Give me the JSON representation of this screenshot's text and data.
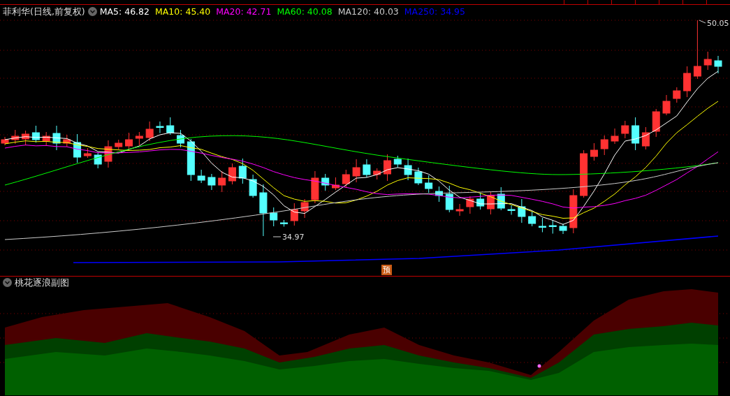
{
  "header": {
    "stock_title": "菲利华(日线,前复权)",
    "moving_averages": [
      {
        "label": "MA5: 46.82",
        "color": "#ffffff"
      },
      {
        "label": "MA10: 45.40",
        "color": "#ffff00"
      },
      {
        "label": "MA20: 42.71",
        "color": "#ff00ff"
      },
      {
        "label": "MA60: 40.08",
        "color": "#00ff00"
      },
      {
        "label": "MA120: 40.03",
        "color": "#c8c8c8"
      },
      {
        "label": "MA250: 34.95",
        "color": "#0000ff"
      }
    ]
  },
  "price_chart": {
    "high_label": "50.05",
    "low_label": "34.97",
    "forecast_badge": "预"
  },
  "indicator_panel": {
    "title": "桃花逐浪副图"
  }
}
